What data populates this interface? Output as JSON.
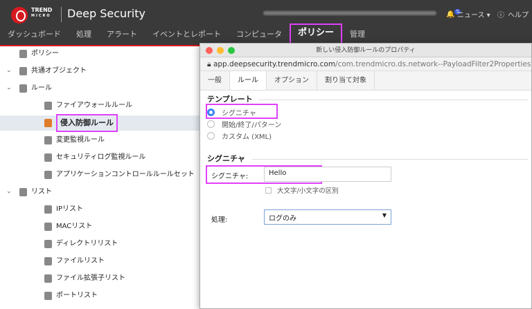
{
  "header": {
    "brand_line1": "TREND",
    "brand_line2": "MICRO",
    "app_title": "Deep Security",
    "news_badge": "5",
    "news": "ニュース ▾",
    "help": "ヘルプ"
  },
  "nav": [
    "ダッシュボード",
    "処理",
    "アラート",
    "イベントとレポート",
    "コンピュータ",
    "ポリシー",
    "管理"
  ],
  "sidebar": [
    {
      "label": "ポリシー",
      "indent": 0,
      "caret": ""
    },
    {
      "label": "共通オブジェクト",
      "indent": 0,
      "caret": "⌄"
    },
    {
      "label": "ルール",
      "indent": 1,
      "caret": "⌄"
    },
    {
      "label": "ファイアウォールルール",
      "indent": 2,
      "caret": ""
    },
    {
      "label": "侵入防御ルール",
      "indent": 2,
      "caret": ""
    },
    {
      "label": "変更監視ルール",
      "indent": 2,
      "caret": ""
    },
    {
      "label": "セキュリティログ監視ルール",
      "indent": 2,
      "caret": ""
    },
    {
      "label": "アプリケーションコントロールルールセット",
      "indent": 2,
      "caret": ""
    },
    {
      "label": "リスト",
      "indent": 1,
      "caret": "⌄"
    },
    {
      "label": "IPリスト",
      "indent": 2,
      "caret": ""
    },
    {
      "label": "MACリスト",
      "indent": 2,
      "caret": ""
    },
    {
      "label": "ディレクトリリスト",
      "indent": 2,
      "caret": ""
    },
    {
      "label": "ファイルリスト",
      "indent": 2,
      "caret": ""
    },
    {
      "label": "ファイル拡張子リスト",
      "indent": 2,
      "caret": ""
    },
    {
      "label": "ポートリスト",
      "indent": 2,
      "caret": ""
    }
  ],
  "dialog": {
    "title": "新しい侵入防御ルールのプロパティ",
    "url_host": "app.deepsecurity.trendmicro.com",
    "url_path": "/com.trendmicro.ds.network--PayloadFilter2Properties...",
    "tabs": [
      "一般",
      "ルール",
      "オプション",
      "割り当て対象"
    ],
    "template_heading": "テンプレート",
    "templates": [
      "シグニチャ",
      "開始/終了/パターン",
      "カスタム (XML)"
    ],
    "signature_heading": "シグニチャ",
    "signature_label": "シグニチャ:",
    "signature_value": "Hello",
    "case_label": "大文字/小文字の区別",
    "action_label": "処理:",
    "action_value": "ログのみ"
  }
}
